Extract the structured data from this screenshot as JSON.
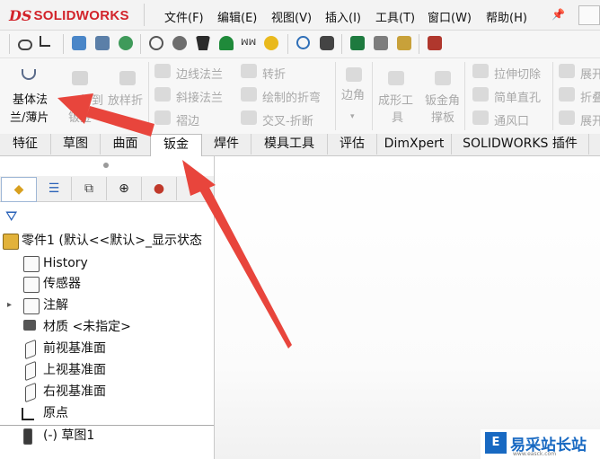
{
  "app": {
    "logo_ds": "DS",
    "logo_name": "SOLIDWORKS"
  },
  "menu": [
    "文件(F)",
    "编辑(E)",
    "视图(V)",
    "插入(I)",
    "工具(T)",
    "窗口(W)",
    "帮助(H)"
  ],
  "ribbon": {
    "base_flange": [
      "基体法",
      "兰/薄片"
    ],
    "lofted_bend_upper": [
      "放样折"
    ],
    "convert": [
      "转到",
      "钣金"
    ],
    "edge_flange": "边线法兰",
    "miter_flange": "斜接法兰",
    "hem": "褶边",
    "jog": "转折",
    "sketched_bend": "绘制的折弯",
    "cross_break": "交叉-折断",
    "corners": "边角",
    "forming_tool": [
      "成形工",
      "具"
    ],
    "sheet_metal_gusset": [
      "钣金角",
      "撑板"
    ],
    "extruded_cut": "拉伸切除",
    "simple_hole": "简单直孔",
    "vent": "通风口",
    "unfold": "展开",
    "fold": "折叠",
    "flatten": "展开"
  },
  "tabs": [
    "特征",
    "草图",
    "曲面",
    "钣金",
    "焊件",
    "模具工具",
    "评估",
    "DimXpert",
    "SOLIDWORKS 插件"
  ],
  "selected_tab": "钣金",
  "tree": {
    "root": "零件1 (默认<<默认>_显示状态",
    "items": [
      "History",
      "传感器",
      "注解",
      "材质 <未指定>",
      "前视基准面",
      "上视基准面",
      "右视基准面",
      "原点",
      "(-) 草图1"
    ]
  },
  "watermark": {
    "logo": "E",
    "text": "易采站长站",
    "sub": "www.easck.com"
  },
  "colors": {
    "brand_red": "#d2232a",
    "arrow_red": "#e8453c",
    "accent_blue": "#1869c2"
  }
}
